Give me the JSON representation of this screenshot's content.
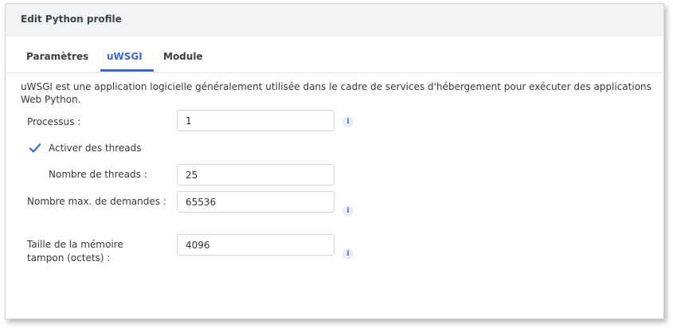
{
  "dialog": {
    "title": "Edit Python profile"
  },
  "tabs": [
    {
      "label": "Paramètres"
    },
    {
      "label": "uWSGI"
    },
    {
      "label": "Module"
    }
  ],
  "active_tab": "uWSGI",
  "description": "uWSGI est une application logicielle généralement utilisée dans le cadre de services d'hébergement pour exécuter des applications Web Python.",
  "fields": {
    "processes": {
      "label": "Processus :",
      "value": "1",
      "info_icon": "info-icon"
    },
    "enable_threads": {
      "label": "Activer des threads",
      "checked": true
    },
    "threads": {
      "label": "Nombre de threads :",
      "value": "25"
    },
    "max_requests": {
      "label": "Nombre max. de demandes :",
      "value": "65536",
      "info_icon": "info-icon"
    },
    "buffer_size": {
      "label": "Taille de la mémoire tampon (octets) :",
      "value": "4096",
      "info_icon": "info-icon"
    }
  },
  "colors": {
    "accent": "#3f67c3",
    "titlebar_bg": "#f2f3f5"
  }
}
